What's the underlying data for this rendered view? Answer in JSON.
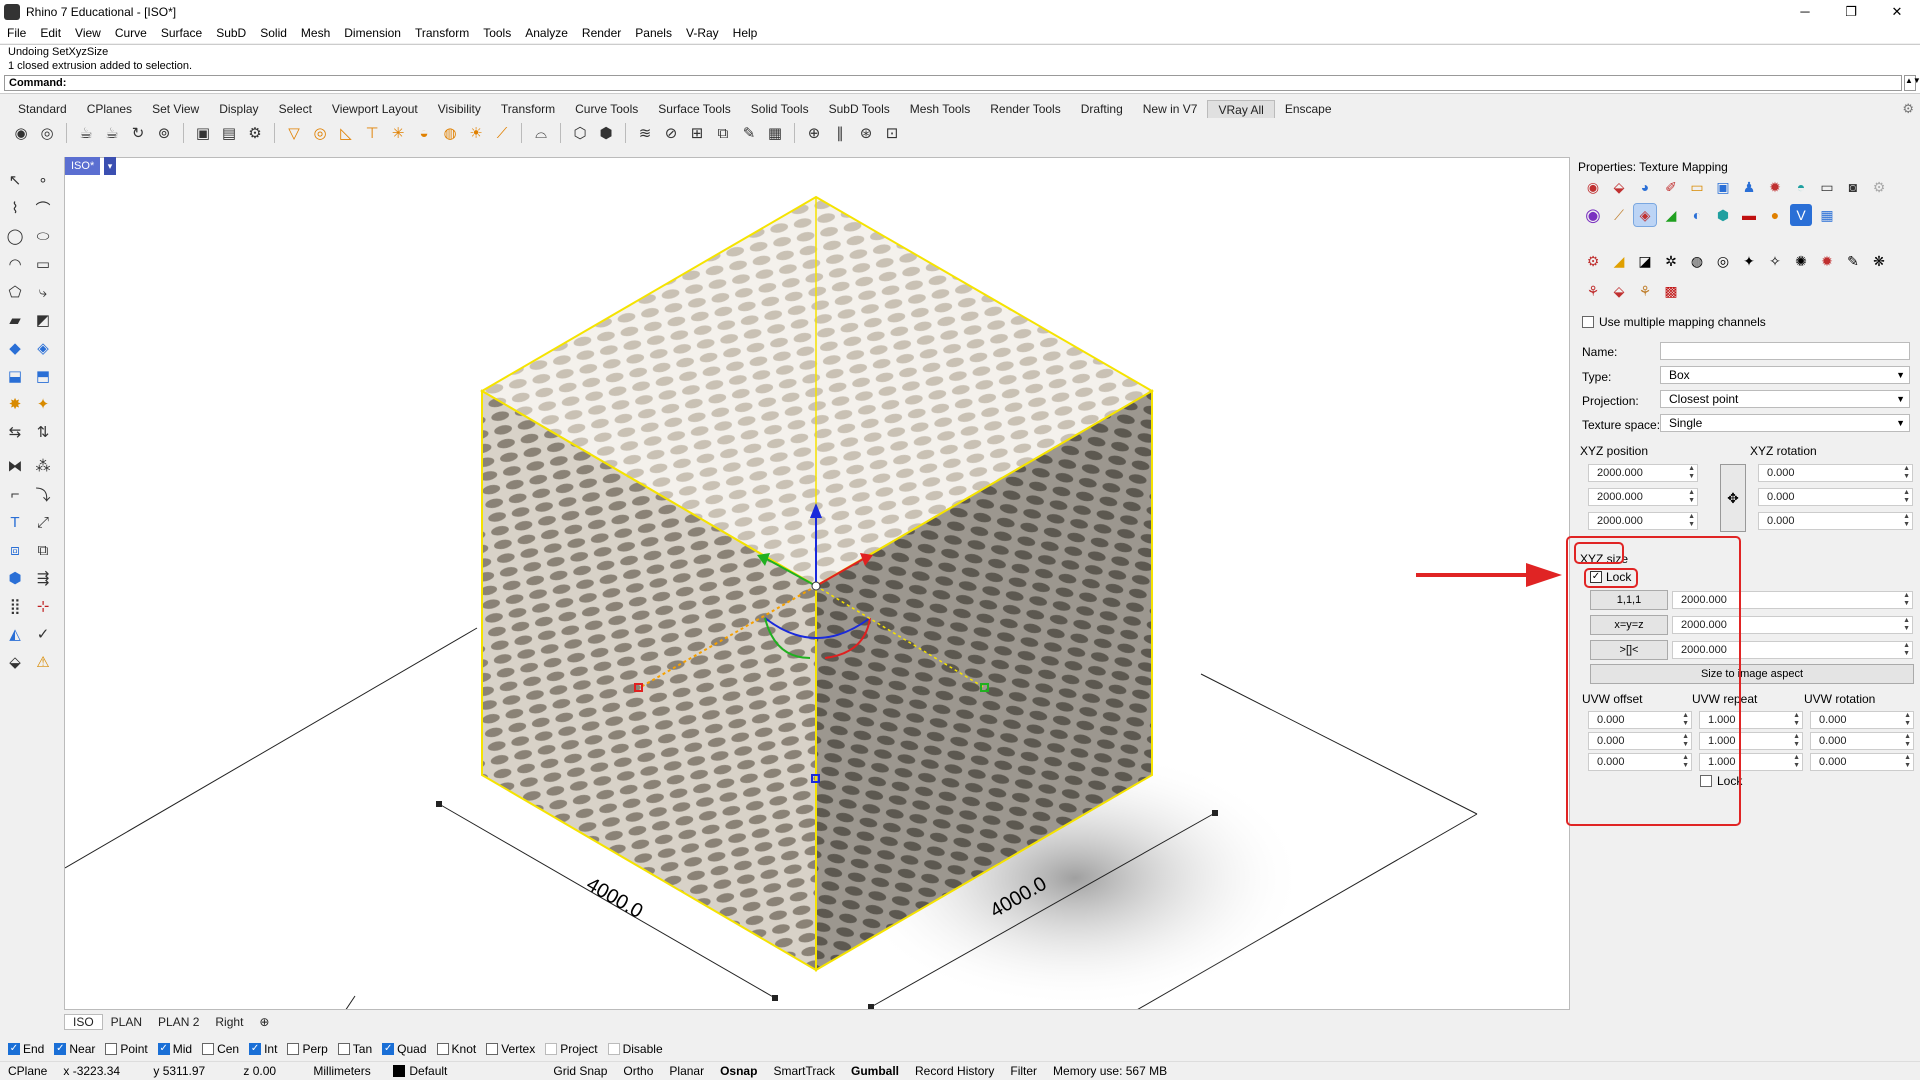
{
  "titlebar": {
    "title": "Rhino 7 Educational - [ISO*]",
    "minimize": "─",
    "maximize": "❐",
    "close": "✕"
  },
  "menu": [
    "File",
    "Edit",
    "View",
    "Curve",
    "Surface",
    "SubD",
    "Solid",
    "Mesh",
    "Dimension",
    "Transform",
    "Tools",
    "Analyze",
    "Render",
    "Panels",
    "V-Ray",
    "Help"
  ],
  "command": {
    "history": [
      "Undoing SetXyzSize",
      "1 closed extrusion added to selection."
    ],
    "prompt": "Command:"
  },
  "tabs": [
    "Standard",
    "CPlanes",
    "Set View",
    "Display",
    "Select",
    "Viewport Layout",
    "Visibility",
    "Transform",
    "Curve Tools",
    "Surface Tools",
    "Solid Tools",
    "SubD Tools",
    "Mesh Tools",
    "Render Tools",
    "Drafting",
    "New in V7",
    "VRay All",
    "Enscape"
  ],
  "active_tab": "VRay All",
  "viewport": {
    "label": "ISO*",
    "dim_left": "4000.0",
    "dim_right": "4000.0"
  },
  "viewport_tabs": [
    "ISO",
    "PLAN",
    "PLAN 2",
    "Right"
  ],
  "osnaps": [
    {
      "label": "End",
      "on": true
    },
    {
      "label": "Near",
      "on": true
    },
    {
      "label": "Point",
      "on": false
    },
    {
      "label": "Mid",
      "on": true
    },
    {
      "label": "Cen",
      "on": false
    },
    {
      "label": "Int",
      "on": true
    },
    {
      "label": "Perp",
      "on": false
    },
    {
      "label": "Tan",
      "on": false
    },
    {
      "label": "Quad",
      "on": true
    },
    {
      "label": "Knot",
      "on": false
    },
    {
      "label": "Vertex",
      "on": false
    },
    {
      "label": "Project",
      "on": false
    },
    {
      "label": "Disable",
      "on": false
    }
  ],
  "status": {
    "cplane": "CPlane",
    "x": "x -3223.34",
    "y": "y 5311.97",
    "z": "z 0.00",
    "units": "Millimeters",
    "layer": "Default",
    "grid_snap": "Grid Snap",
    "ortho": "Ortho",
    "planar": "Planar",
    "osnap": "Osnap",
    "smarttrack": "SmartTrack",
    "gumball": "Gumball",
    "record_history": "Record History",
    "filter": "Filter",
    "memory": "Memory use: 567 MB"
  },
  "panel": {
    "title": "Properties: Texture Mapping",
    "multi_channels": "Use multiple mapping channels",
    "name_label": "Name:",
    "name_value": "",
    "type_label": "Type:",
    "type_value": "Box",
    "projection_label": "Projection:",
    "projection_value": "Closest point",
    "texture_space_label": "Texture space:",
    "texture_space_value": "Single",
    "xyz_position_label": "XYZ position",
    "xyz_rotation_label": "XYZ rotation",
    "xyz_position": [
      "2000.000",
      "2000.000",
      "2000.000"
    ],
    "xyz_rotation": [
      "0.000",
      "0.000",
      "0.000"
    ],
    "xyz_size_label": "XYZ size",
    "lock_label": "Lock",
    "size_buttons": [
      "1,1,1",
      "x=y=z",
      ">[]<"
    ],
    "xyz_size": [
      "2000.000",
      "2000.000",
      "2000.000"
    ],
    "size_to_image": "Size to image aspect",
    "uvw_offset_label": "UVW offset",
    "uvw_repeat_label": "UVW repeat",
    "uvw_rotation_label": "UVW rotation",
    "uvw_offset": [
      "0.000",
      "0.000",
      "0.000"
    ],
    "uvw_repeat": [
      "1.000",
      "1.000",
      "1.000"
    ],
    "uvw_rotation": [
      "0.000",
      "0.000",
      "0.000"
    ],
    "uvw_lock_label": "Lock"
  }
}
